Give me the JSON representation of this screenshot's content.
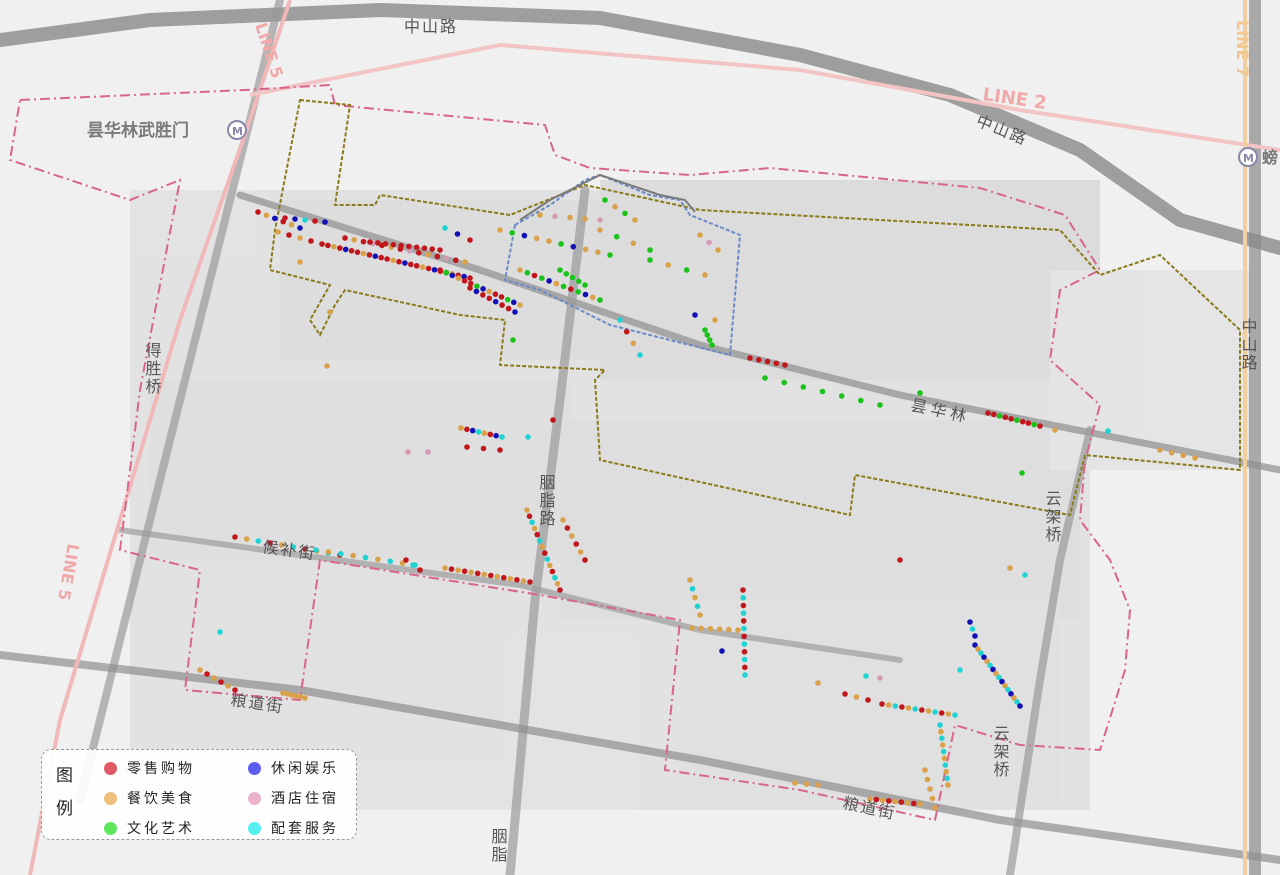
{
  "roads": {
    "zhongshan_top": "中山路",
    "zhongshan_mid": "中山路",
    "zhongshan_right": "中山路",
    "desheng": "得胜桥",
    "yanzhi_mid": "胭脂路",
    "yanzhi_bottom": "胭脂",
    "houbu": "候补街",
    "liangdao_left": "粮道街",
    "liangdao_right": "粮道街",
    "yunjia_right": "云架桥",
    "yunjia_bottom": "云架桥",
    "tanhualin": "昙华林"
  },
  "metro": {
    "line2": "LINE 2",
    "line5_top": "LINE 5",
    "line5_bottom": "LINE 5",
    "line7": "LINE 7",
    "station_left": "昙华林武胜门",
    "station_right": "螃"
  },
  "legend": {
    "title": "图例",
    "items": [
      {
        "label": "零售购物",
        "color": "#e05a66"
      },
      {
        "label": "餐饮美食",
        "color": "#ecc07a"
      },
      {
        "label": "文化艺术",
        "color": "#5ee65e"
      },
      {
        "label": "休闲娱乐",
        "color": "#5c5cf0"
      },
      {
        "label": "酒店住宿",
        "color": "#ebb3cc"
      },
      {
        "label": "配套服务",
        "color": "#55f0f0"
      }
    ]
  },
  "colors": {
    "retail": "#c0161c",
    "food": "#d9a24a",
    "culture": "#19c319",
    "leisure": "#1010b4",
    "hotel": "#d49ab6",
    "service": "#1fd3d3",
    "boundary_pink": "#d9648c",
    "boundary_olive": "#8a7a1a",
    "boundary_blue": "#6a8ac8"
  }
}
